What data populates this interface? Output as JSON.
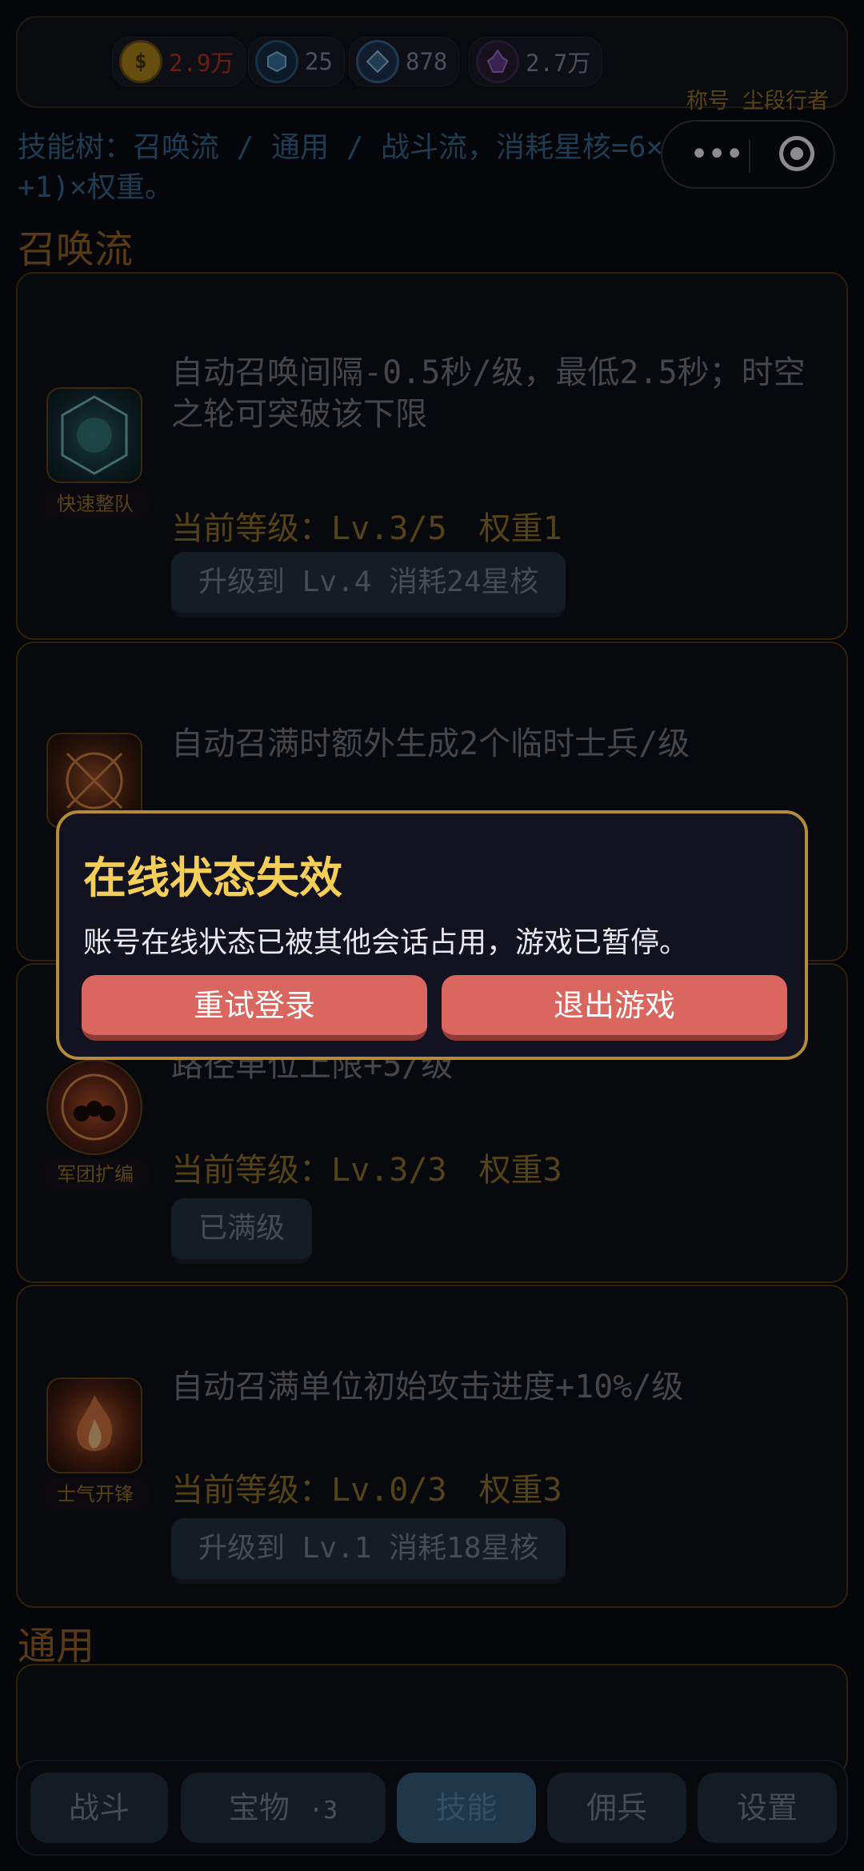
{
  "resources": {
    "gold": "2.9万",
    "hex_blue": "25",
    "hex_steel": "878",
    "crystal": "2.7万"
  },
  "title_label": "称号  尘段行者",
  "intro": "技能树：召唤流 / 通用 / 战斗流，消耗星核=6×(当前等级+1)×权重。",
  "sections": {
    "summon": "召唤流",
    "general": "通用"
  },
  "skills": [
    {
      "name": "快速整队",
      "desc": "自动召唤间隔-0.5秒/级，最低2.5秒；时空之轮可突破该下限",
      "level": "当前等级：Lv.3/5",
      "weight": "权重1",
      "action": "升级到 Lv.4  消耗24星核"
    },
    {
      "name": "",
      "desc": "自动召满时额外生成2个临时士兵/级",
      "level": "",
      "weight": "",
      "action": ""
    },
    {
      "name": "军团扩编",
      "desc": "路径单位上限+5/级",
      "level": "当前等级：Lv.3/3",
      "weight": "权重3",
      "action": "已满级"
    },
    {
      "name": "士气开锋",
      "desc": "自动召满单位初始攻击进度+10%/级",
      "level": "当前等级：Lv.0/3",
      "weight": "权重3",
      "action": "升级到 Lv.1  消耗18星核"
    }
  ],
  "modal": {
    "title": "在线状态失效",
    "message": "账号在线状态已被其他会话占用，游戏已暂停。",
    "retry": "重试登录",
    "exit": "退出游戏"
  },
  "nav": {
    "battle": "战斗",
    "treasure": "宝物",
    "treasure_badge": "·3",
    "skills": "技能",
    "mercenary": "佣兵",
    "settings": "设置"
  }
}
